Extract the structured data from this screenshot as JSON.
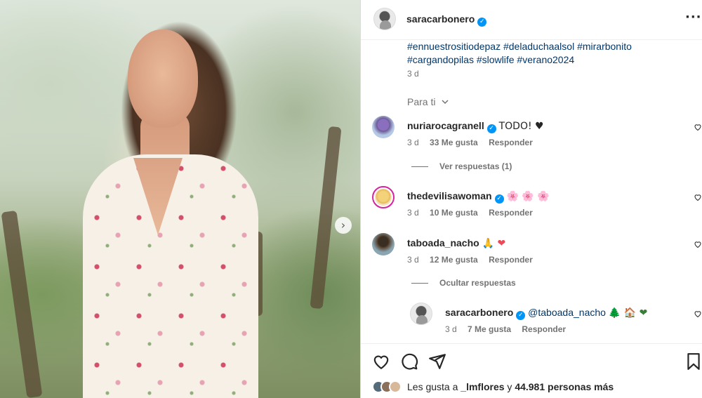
{
  "post": {
    "author": "saracarbonero",
    "caption_lines": [
      "#ennuestrositiodepaz #deladuchaalsol #mirarbonito",
      "#cargandopilas #slowlife #verano2024"
    ],
    "caption_time": "3 d",
    "sort_label": "Para ti"
  },
  "comments": [
    {
      "username": "nuriarocagranell",
      "verified": true,
      "text": "TODO! ♥",
      "time": "3 d",
      "likes": "33 Me gusta",
      "reply": "Responder",
      "view_replies": "Ver respuestas (1)"
    },
    {
      "username": "thedevilisawoman",
      "verified": true,
      "text": "🌸 🌸 🌸",
      "time": "3 d",
      "likes": "10 Me gusta",
      "reply": "Responder"
    },
    {
      "username": "taboada_nacho",
      "verified": false,
      "text": "🙏 ❤",
      "time": "3 d",
      "likes": "12 Me gusta",
      "reply": "Responder",
      "hide_replies": "Ocultar respuestas"
    }
  ],
  "reply": {
    "username": "saracarbonero",
    "verified": true,
    "mention": "@taboada_nacho",
    "emojis": "🌲 🏠 ❤",
    "time": "3 d",
    "likes": "7 Me gusta",
    "reply": "Responder"
  },
  "likes_summary": {
    "prefix": "Les gusta a",
    "user": "_lmflores",
    "connector": "y",
    "count": "44.981 personas más"
  },
  "icons": {
    "more": "more-horizontal-icon",
    "carousel_next": "chevron-right-icon",
    "like": "heart-icon",
    "comment": "comment-bubble-icon",
    "share": "paper-plane-icon",
    "save": "bookmark-icon",
    "verified": "verified-badge-icon"
  },
  "colors": {
    "verified": "#0095f6",
    "link": "#00376b",
    "muted": "#737373",
    "heart_red": "#ed4956"
  }
}
